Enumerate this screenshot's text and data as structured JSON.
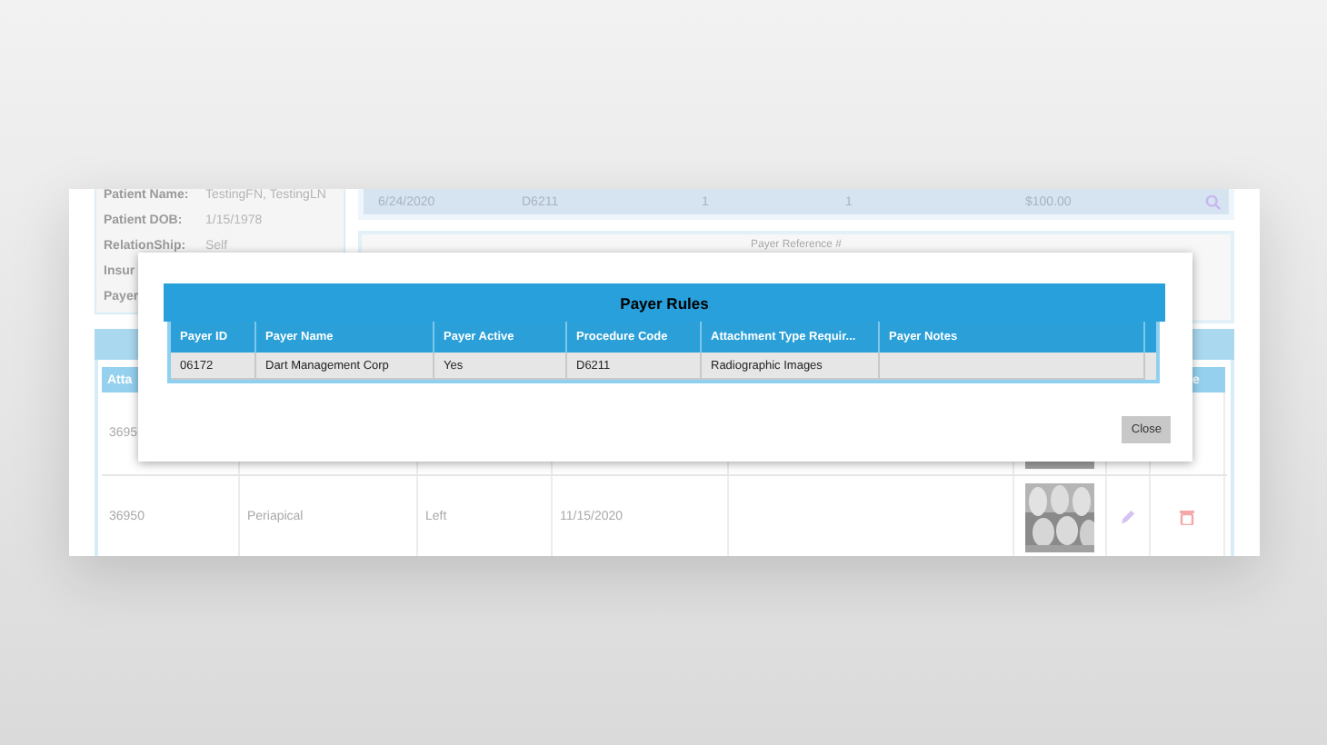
{
  "patient_info": [
    {
      "label": "Patient Name:",
      "value": "TestingFN, TestingLN"
    },
    {
      "label": "Patient DOB:",
      "value": "1/15/1978"
    },
    {
      "label": "RelationShip:",
      "value": "Self"
    },
    {
      "label": "Insur"
    },
    {
      "label": "Payer"
    }
  ],
  "procedure_row": [
    "6/24/2020",
    "D6211",
    "1",
    "1",
    "$100.00"
  ],
  "payer_reference_label": "Payer Reference #",
  "attachments": {
    "columns": [
      "Atta",
      "e"
    ],
    "rows": [
      {
        "cells": [
          "3695"
        ],
        "thumbnail": true,
        "actions": false
      },
      {
        "cells": [
          "36950",
          "Periapical",
          "Left",
          "11/15/2020"
        ],
        "thumbnail": true,
        "actions": true
      }
    ]
  },
  "dialog": {
    "title": "Payer Rules",
    "columns": [
      "Payer ID",
      "Payer Name",
      "Payer Active",
      "Procedure Code",
      "Attachment Type Requir...",
      "Payer Notes"
    ],
    "rows": [
      [
        "06172",
        "Dart Management Corp",
        "Yes",
        "D6211",
        "Radiographic Images"
      ]
    ],
    "buttons": [
      "Close"
    ]
  }
}
